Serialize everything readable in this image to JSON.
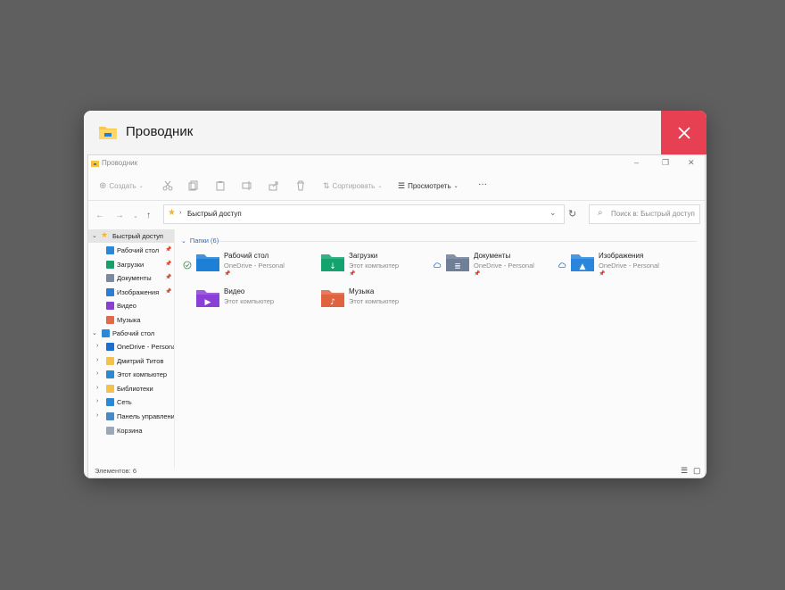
{
  "card": {
    "title": "Проводник"
  },
  "window": {
    "title": "Проводник",
    "controls": {
      "minimize": "–",
      "maximize": "❐",
      "close": "✕"
    }
  },
  "toolbar": {
    "create_label": "Создать",
    "sort_label": "Сортировать",
    "view_label": "Просмотреть",
    "more_label": "···"
  },
  "address": {
    "path": "Быстрый доступ",
    "search_placeholder": "Поиск в: Быстрый доступ"
  },
  "sidebar": {
    "quick_access": "Быстрый доступ",
    "pinned": [
      {
        "label": "Рабочий стол",
        "icon": "desktop-icon",
        "color": "#2b88d8"
      },
      {
        "label": "Загрузки",
        "icon": "download-icon",
        "color": "#1a9e6a"
      },
      {
        "label": "Документы",
        "icon": "document-icon",
        "color": "#7a8aa0"
      },
      {
        "label": "Изображения",
        "icon": "pictures-icon",
        "color": "#2a7fd4"
      },
      {
        "label": "Видео",
        "icon": "video-icon",
        "color": "#8a3fd1"
      },
      {
        "label": "Музыка",
        "icon": "music-icon",
        "color": "#e06a4a"
      }
    ],
    "desktop_root": "Рабочий стол",
    "tree": [
      {
        "label": "OneDrive - Personal",
        "icon": "cloud-icon",
        "color": "#1f6fd1"
      },
      {
        "label": "Дмитрий Титов",
        "icon": "folder-icon",
        "color": "#f2c14e"
      },
      {
        "label": "Этот компьютер",
        "icon": "computer-icon",
        "color": "#2a8ad4"
      },
      {
        "label": "Библиотеки",
        "icon": "folder-icon",
        "color": "#f2c14e"
      },
      {
        "label": "Сеть",
        "icon": "network-icon",
        "color": "#2a8ad4"
      },
      {
        "label": "Панель управления",
        "icon": "control-panel-icon",
        "color": "#4a8ac4"
      },
      {
        "label": "Корзина",
        "icon": "recycle-bin-icon",
        "color": "#9aa8b8"
      }
    ]
  },
  "content": {
    "group_label": "Папки (6)",
    "folders": [
      {
        "name": "Рабочий стол",
        "sub": "OneDrive - Personal",
        "pinned": true,
        "status": "synced",
        "color": "#1e7fd6",
        "glyph": ""
      },
      {
        "name": "Загрузки",
        "sub": "Этот компьютер",
        "pinned": true,
        "status": "",
        "color": "#14a36f",
        "glyph": "↓"
      },
      {
        "name": "Документы",
        "sub": "OneDrive - Personal",
        "pinned": true,
        "status": "cloud",
        "color": "#6f7f98",
        "glyph": "≣"
      },
      {
        "name": "Изображения",
        "sub": "OneDrive - Personal",
        "pinned": true,
        "status": "cloud",
        "color": "#2a86dc",
        "glyph": "▲"
      },
      {
        "name": "Видео",
        "sub": "Этот компьютер",
        "pinned": false,
        "status": "",
        "color": "#8b3fd6",
        "glyph": "▶"
      },
      {
        "name": "Музыка",
        "sub": "Этот компьютер",
        "pinned": false,
        "status": "",
        "color": "#e0633f",
        "glyph": "♪"
      }
    ]
  },
  "status_bar": {
    "items_label": "Элементов: 6"
  }
}
